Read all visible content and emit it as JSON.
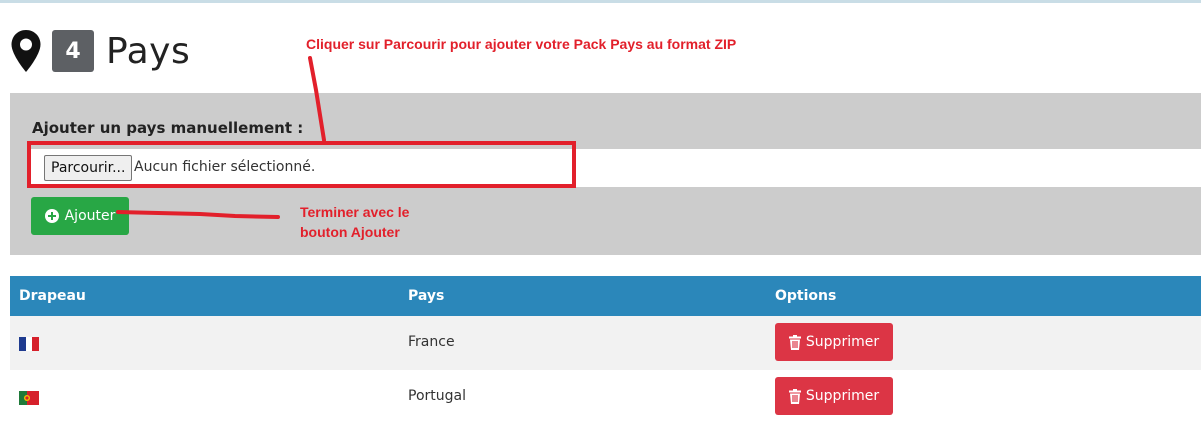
{
  "header": {
    "count": "4",
    "title": "Pays"
  },
  "upload": {
    "label": "Ajouter un pays manuellement :",
    "browse_label": "Parcourir...",
    "file_status": "Aucun fichier sélectionné.",
    "add_label": "Ajouter"
  },
  "annotations": {
    "top": "Cliquer sur Parcourir pour ajouter votre Pack Pays au format ZIP",
    "bottom": "Terminer avec le bouton Ajouter"
  },
  "table": {
    "columns": [
      "Drapeau",
      "Pays",
      "Options"
    ],
    "rows": [
      {
        "flag": "france-flag-icon",
        "country": "France",
        "action": "Supprimer"
      },
      {
        "flag": "portugal-flag-icon",
        "country": "Portugal",
        "action": "Supprimer"
      }
    ]
  },
  "colors": {
    "header_bar": "#2b87ba",
    "panel": "#cccccc",
    "add_button": "#28a745",
    "delete_button": "#dc3545",
    "annotation": "#e2202b",
    "badge": "#5d6064"
  }
}
